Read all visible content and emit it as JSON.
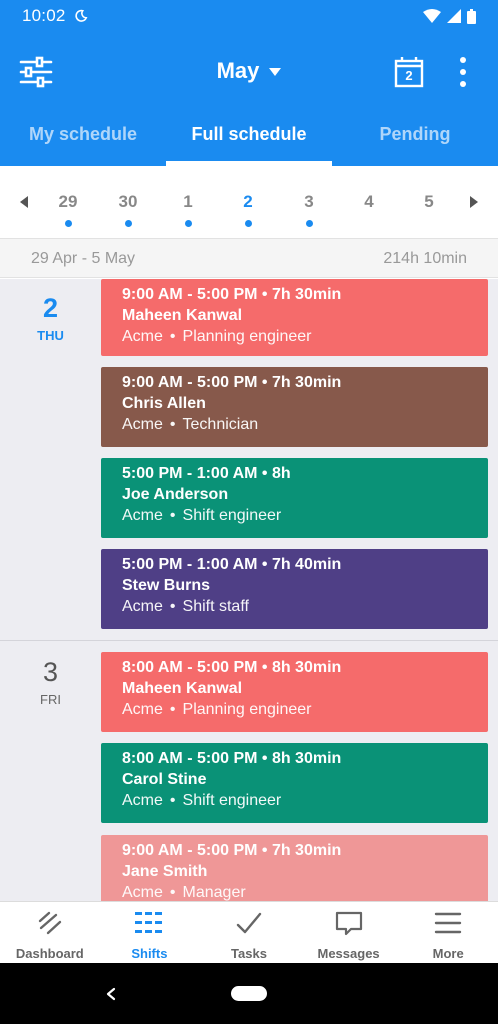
{
  "status_bar": {
    "time": "10:02"
  },
  "app_bar": {
    "title": "May",
    "calendar_day": "2"
  },
  "tabs": [
    {
      "label": "My schedule",
      "active": false
    },
    {
      "label": "Full schedule",
      "active": true
    },
    {
      "label": "Pending",
      "active": false
    }
  ],
  "date_strip": {
    "days": [
      {
        "num": "29",
        "dot": true,
        "selected": false
      },
      {
        "num": "30",
        "dot": true,
        "selected": false
      },
      {
        "num": "1",
        "dot": true,
        "selected": false
      },
      {
        "num": "2",
        "dot": true,
        "selected": true
      },
      {
        "num": "3",
        "dot": true,
        "selected": false
      },
      {
        "num": "4",
        "dot": false,
        "selected": false
      },
      {
        "num": "5",
        "dot": false,
        "selected": false
      }
    ]
  },
  "range": {
    "label": "29 Apr - 5 May",
    "total": "214h 10min"
  },
  "schedule": [
    {
      "day_num": "2",
      "day_name": "THU",
      "today": true,
      "shifts": [
        {
          "time": "9:00 AM - 5:00 PM • 7h 30min",
          "name": "Maheen Kanwal",
          "company": "Acme",
          "role": "Planning engineer",
          "color": "#f56b6b"
        },
        {
          "time": "9:00 AM - 5:00 PM • 7h 30min",
          "name": "Chris Allen",
          "company": "Acme",
          "role": "Technician",
          "color": "#87594b"
        },
        {
          "time": "5:00 PM - 1:00 AM • 8h",
          "name": "Joe Anderson",
          "company": "Acme",
          "role": "Shift engineer",
          "color": "#0a9277"
        },
        {
          "time": "5:00 PM - 1:00 AM • 7h 40min",
          "name": "Stew Burns",
          "company": "Acme",
          "role": "Shift staff",
          "color": "#4f3f86"
        }
      ]
    },
    {
      "day_num": "3",
      "day_name": "FRI",
      "today": false,
      "shifts": [
        {
          "time": "8:00 AM - 5:00 PM • 8h 30min",
          "name": "Maheen Kanwal",
          "company": "Acme",
          "role": "Planning engineer",
          "color": "#f56b6b"
        },
        {
          "time": "8:00 AM - 5:00 PM • 8h 30min",
          "name": "Carol Stine",
          "company": "Acme",
          "role": "Shift engineer",
          "color": "#0a9277"
        },
        {
          "time": "9:00 AM - 5:00 PM • 7h 30min",
          "name": "Jane Smith",
          "company": "Acme",
          "role": "Manager",
          "color": "#ef9797"
        }
      ]
    }
  ],
  "bottom_nav": [
    {
      "label": "Dashboard",
      "icon": "dashboard-icon",
      "active": false
    },
    {
      "label": "Shifts",
      "icon": "shifts-icon",
      "active": true
    },
    {
      "label": "Tasks",
      "icon": "check-icon",
      "active": false
    },
    {
      "label": "Messages",
      "icon": "message-icon",
      "active": false
    },
    {
      "label": "More",
      "icon": "menu-icon",
      "active": false
    }
  ],
  "colors": {
    "primary": "#1a8bf0"
  }
}
